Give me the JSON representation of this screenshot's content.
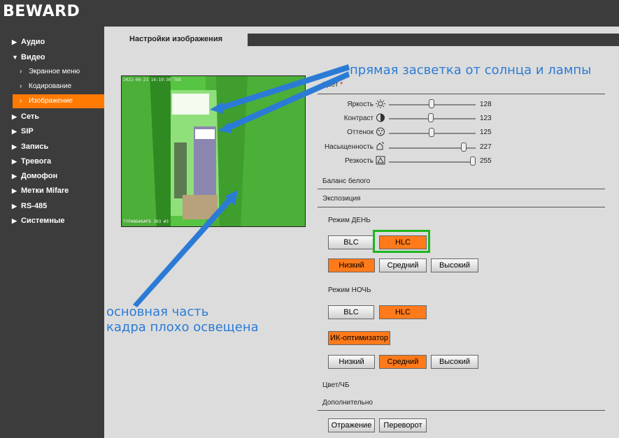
{
  "logo": "BEWARD",
  "sidebar": {
    "items": [
      {
        "label": "Аудио"
      },
      {
        "label": "Видео"
      },
      {
        "label": "Экранное меню"
      },
      {
        "label": "Кодирование"
      },
      {
        "label": "Изображение"
      },
      {
        "label": "Сеть"
      },
      {
        "label": "SIP"
      },
      {
        "label": "Запись"
      },
      {
        "label": "Тревога"
      },
      {
        "label": "Домофон"
      },
      {
        "label": "Метки Mifare"
      },
      {
        "label": "RS-485"
      },
      {
        "label": "Системные"
      }
    ]
  },
  "tab": {
    "label": "Настройки изображения"
  },
  "preview": {
    "timestamp": "2022-06-21 16:19:30 TUE",
    "caption": "TYP#B6#6#FB 303 #3"
  },
  "sections": {
    "color": "Цвет",
    "color_star": "*",
    "white_balance": "Баланс белого",
    "exposure": "Экспозиция",
    "day_mode": "Режим ДЕНЬ",
    "night_mode": "Режим НОЧЬ",
    "color_bw": "Цвет/ЧБ",
    "extra": "Дополнительно"
  },
  "sliders": [
    {
      "label": "Яркость",
      "value": 128,
      "max": 255,
      "icon": "brightness-icon"
    },
    {
      "label": "Контраст",
      "value": 123,
      "max": 255,
      "icon": "contrast-icon"
    },
    {
      "label": "Оттенок",
      "value": 125,
      "max": 255,
      "icon": "hue-icon"
    },
    {
      "label": "Насыщенность",
      "value": 227,
      "max": 255,
      "icon": "saturation-icon"
    },
    {
      "label": "Резкость",
      "value": 255,
      "max": 255,
      "icon": "sharpness-icon"
    }
  ],
  "buttons": {
    "blc": "BLC",
    "hlc": "HLC",
    "low": "Низкий",
    "mid": "Средний",
    "high": "Высокий",
    "ir": "ИК-оптимизатор",
    "mirror": "Отражение",
    "flip": "Переворот"
  },
  "day": {
    "selected_mode": "HLC",
    "selected_level": "Низкий"
  },
  "night": {
    "selected_mode": "HLC",
    "ir_optimizer": true,
    "selected_level": "Средний"
  },
  "annotations": {
    "top": "прямая засветка от солнца и лампы",
    "bottom_line1": "основная часть",
    "bottom_line2": "кадра плохо освещена"
  },
  "colors": {
    "accent": "#ff7a00",
    "annotation": "#2b7bd6",
    "highlight": "#1db51d"
  }
}
